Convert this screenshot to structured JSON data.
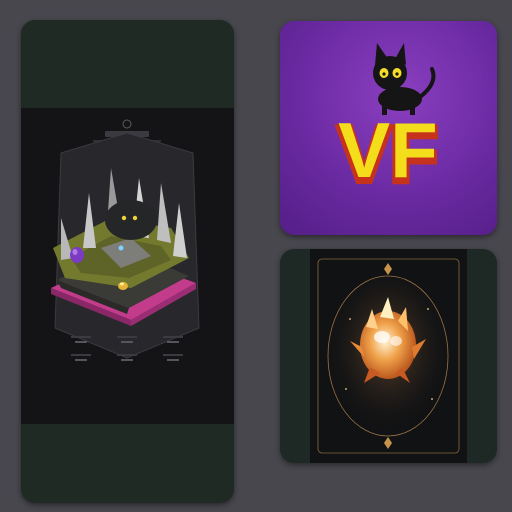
{
  "cards": [
    {
      "id": "land",
      "header_text": "",
      "stats": []
    },
    {
      "id": "vf",
      "logo_text": "VF"
    },
    {
      "id": "egg"
    }
  ],
  "colors": {
    "background": "#48474e",
    "land_card": "#1f2a25",
    "vf_purple": "#6a2aa2",
    "vf_yellow": "#f4dd1a",
    "vf_red": "#c7321c",
    "egg_card": "#1e2925",
    "egg_gold": "#c9934a"
  },
  "icons": [
    "black-cat-icon",
    "crystal-egg-icon",
    "floating-island-icon",
    "purple-egg-icon",
    "golden-egg-icon"
  ]
}
